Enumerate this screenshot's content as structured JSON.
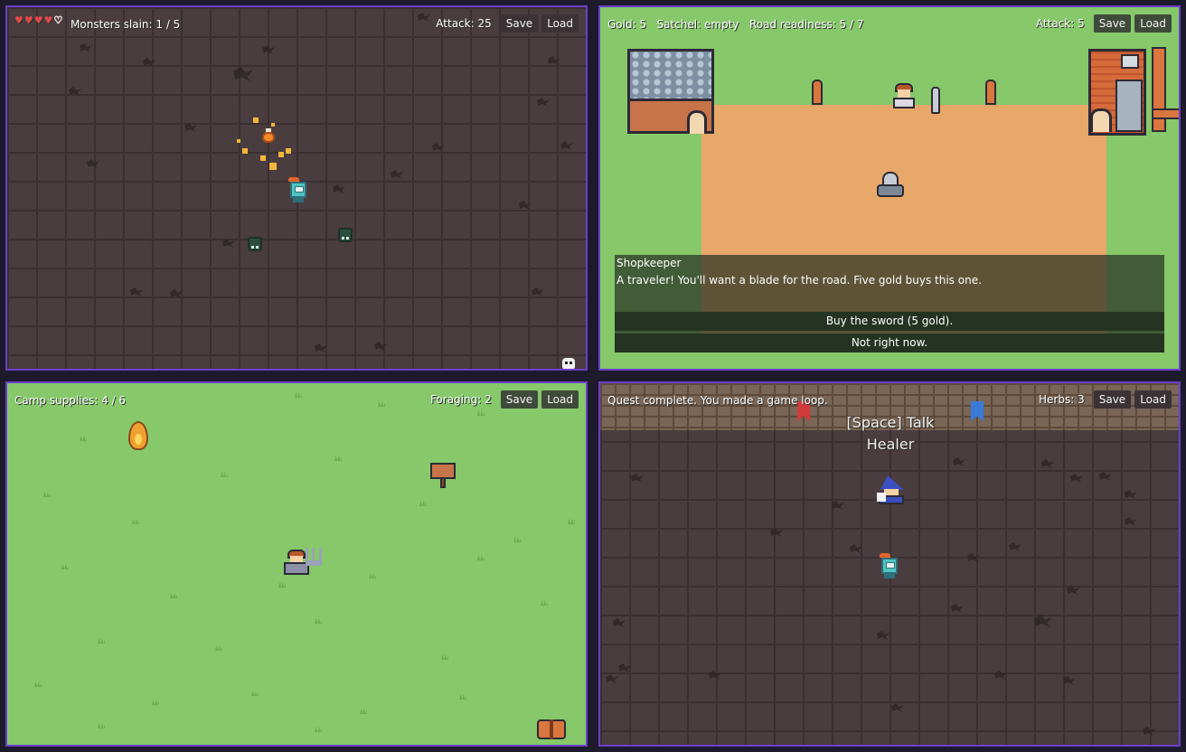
{
  "pane1": {
    "hearts": [
      "♥",
      "♥",
      "♥",
      "♥",
      "♡"
    ],
    "status": "Monsters slain: 1 / 5",
    "attack": "Attack: 25",
    "save_label": "Save",
    "load_label": "Load"
  },
  "pane2": {
    "gold": "Gold: 5",
    "satchel": "Satchel: empty",
    "readiness": "Road readiness: 5 / 7",
    "attack": "Attack: 5",
    "save_label": "Save",
    "load_label": "Load",
    "dialog": {
      "speaker": "Shopkeeper",
      "message": "A traveler! You'll want a blade for the road. Five gold buys this one.",
      "choices": [
        "Buy the sword (5 gold).",
        "Not right now."
      ]
    }
  },
  "pane3": {
    "supplies": "Camp supplies: 4 / 6",
    "foraging": "Foraging: 2",
    "save_label": "Save",
    "load_label": "Load"
  },
  "pane4": {
    "quest": "Quest complete. You made a game loop.",
    "herbs": "Herbs: 3",
    "save_label": "Save",
    "load_label": "Load",
    "prompt": "[Space] Talk",
    "npc_name": "Healer"
  },
  "colors": {
    "pane_border": "#6a3fc9",
    "grass": "#86c86a",
    "dungeon_floor": "#4a3d3f",
    "dirt": "#e8a86a",
    "banner_red": "#d23a3a",
    "banner_blue": "#3a7ad8"
  }
}
